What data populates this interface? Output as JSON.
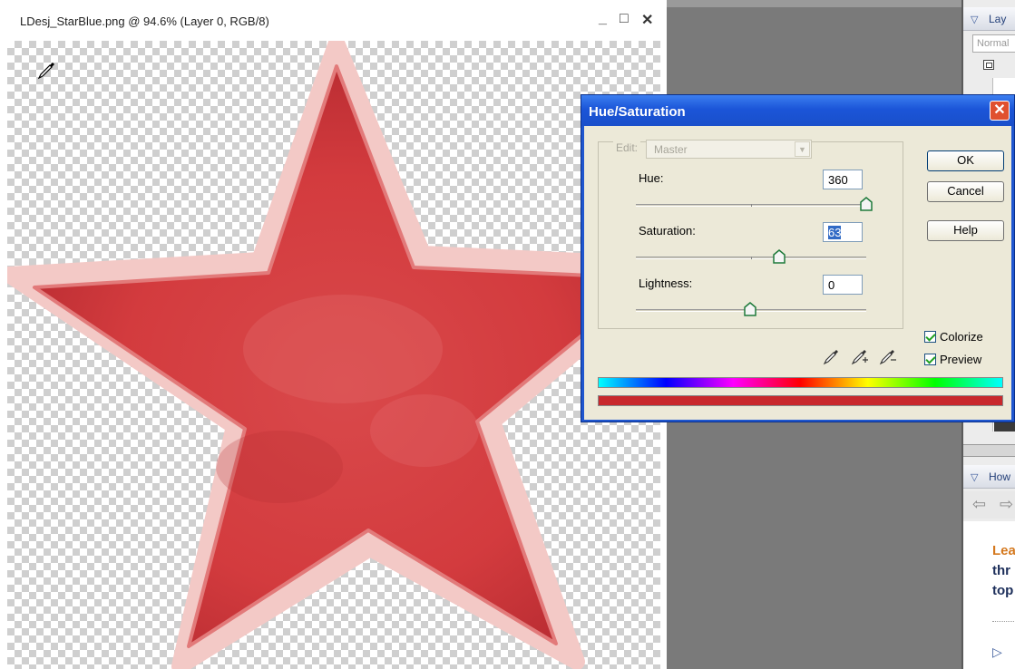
{
  "document": {
    "title": "LDesj_StarBlue.png @ 94.6% (Layer 0, RGB/8)",
    "window_controls": {
      "minimize": "_",
      "maximize": "□",
      "close": "✕"
    },
    "cursor_icon": "eyedropper-icon",
    "star_color": "#d63c3f",
    "star_border_color": "#f3c9c6"
  },
  "palette": {
    "layers_header": "Lay",
    "blend_mode": "Normal",
    "help_header": "How",
    "help_text": [
      "Lea",
      "thr",
      "top"
    ]
  },
  "dialog": {
    "title": "Hue/Saturation",
    "close_label": "✕",
    "edit_label": "Edit:",
    "edit_value": "Master",
    "hue": {
      "label": "Hue:",
      "value": "360",
      "slider_fraction": 1.0
    },
    "saturation": {
      "label": "Saturation:",
      "value": "63",
      "slider_fraction": 0.63
    },
    "lightness": {
      "label": "Lightness:",
      "value": "0",
      "slider_fraction": 0.5
    },
    "buttons": {
      "ok": "OK",
      "cancel": "Cancel",
      "help": "Help"
    },
    "colorize": {
      "label": "Colorize",
      "checked": true
    },
    "preview": {
      "label": "Preview",
      "checked": true
    },
    "eyedropper_icons": [
      "eyedropper-icon",
      "eyedropper-plus-icon",
      "eyedropper-minus-icon"
    ],
    "result_color": "#c8282c"
  }
}
